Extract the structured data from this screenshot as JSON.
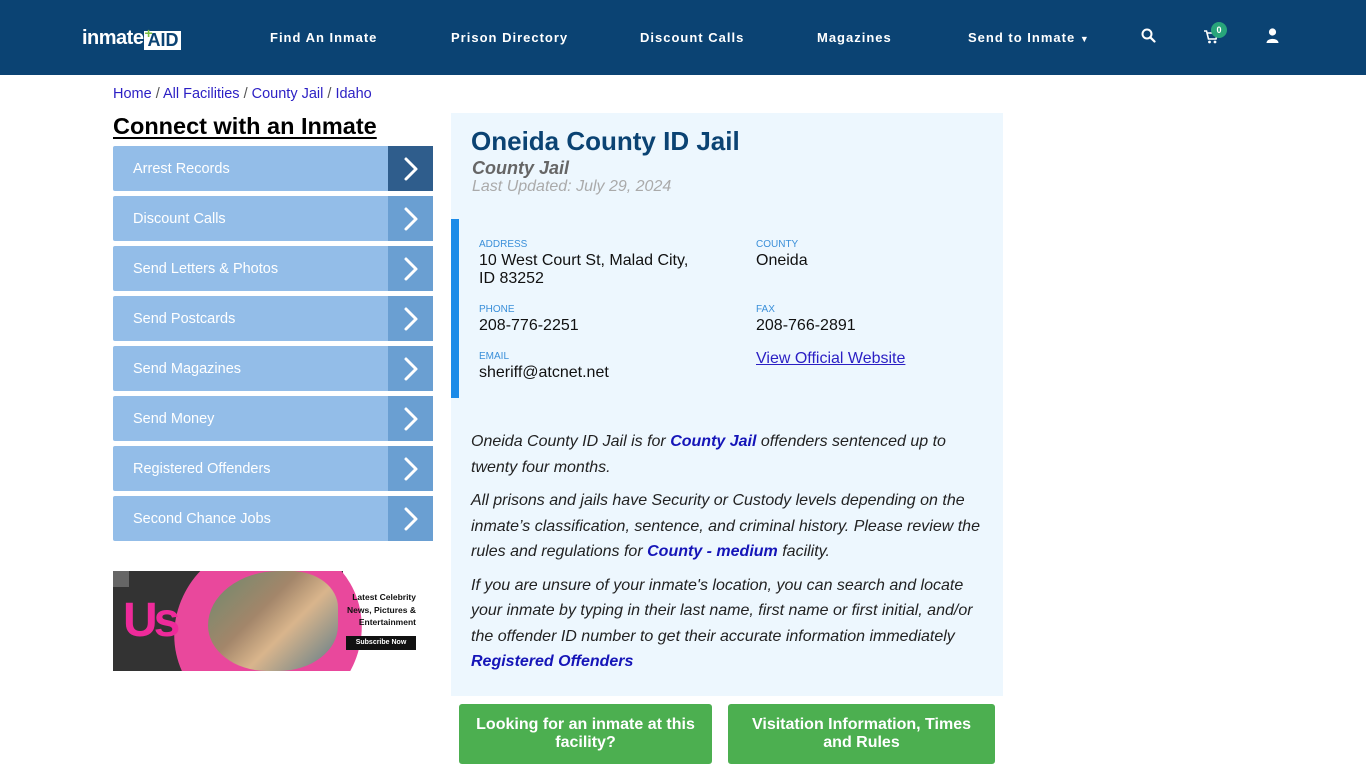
{
  "header": {
    "logo_text": "inmate",
    "logo_badge": "AID",
    "nav": [
      {
        "label": "Find An Inmate"
      },
      {
        "label": "Prison Directory"
      },
      {
        "label": "Discount Calls"
      },
      {
        "label": "Magazines"
      },
      {
        "label": "Send to Inmate"
      }
    ],
    "cart_count": "0"
  },
  "breadcrumb": [
    {
      "label": "Home"
    },
    {
      "label": "All Facilities"
    },
    {
      "label": "County Jail"
    },
    {
      "label": "Idaho"
    }
  ],
  "breadcrumb_separator": "/",
  "sidebar": {
    "title": "Connect with an Inmate",
    "items": [
      {
        "label": "Arrest Records"
      },
      {
        "label": "Discount Calls"
      },
      {
        "label": "Send Letters & Photos"
      },
      {
        "label": "Send Postcards"
      },
      {
        "label": "Send Magazines"
      },
      {
        "label": "Send Money"
      },
      {
        "label": "Registered Offenders"
      },
      {
        "label": "Second Chance Jobs"
      }
    ],
    "ad": {
      "brand": "Us",
      "headline_1": "Latest Celebrity",
      "headline_2": "News, Pictures &",
      "headline_3": "Entertainment",
      "cta": "Subscribe Now"
    }
  },
  "facility": {
    "name": "Oneida County ID Jail",
    "type": "County Jail",
    "last_updated": "Last Updated: July 29, 2024",
    "address_label": "ADDRESS",
    "address_line1": "10 West Court St, Malad City,",
    "address_line2": "ID 83252",
    "county_label": "COUNTY",
    "county": "Oneida",
    "phone_label": "PHONE",
    "phone": "208-776-2251",
    "fax_label": "FAX",
    "fax": "208-766-2891",
    "email_label": "EMAIL",
    "email": "sheriff@atcnet.net",
    "website_link": "View Official Website"
  },
  "description": {
    "p1_a": "Oneida County ID Jail is for ",
    "p1_link": "County Jail",
    "p1_b": " offenders sentenced up to twenty four months.",
    "p2_a": "All prisons and jails have Security or Custody levels depending on the inmate’s classification, sentence, and criminal history. Please review the rules and regulations for ",
    "p2_link": "County - medium",
    "p2_b": " facility.",
    "p3": "If you are unsure of your inmate's location, you can search and locate your inmate by typing in their last name, first name or first initial, and/or the offender ID number to get their accurate information immediately",
    "p3_link": "Registered Offenders"
  },
  "actions": {
    "find_inmate": "Looking for an inmate at this facility?",
    "visitation": "Visitation Information, Times and Rules"
  },
  "colors": {
    "nav_bg": "#0b4373",
    "accent_blue": "#1b8be8",
    "menu_bg": "#93bde8",
    "green": "#4caf50"
  }
}
